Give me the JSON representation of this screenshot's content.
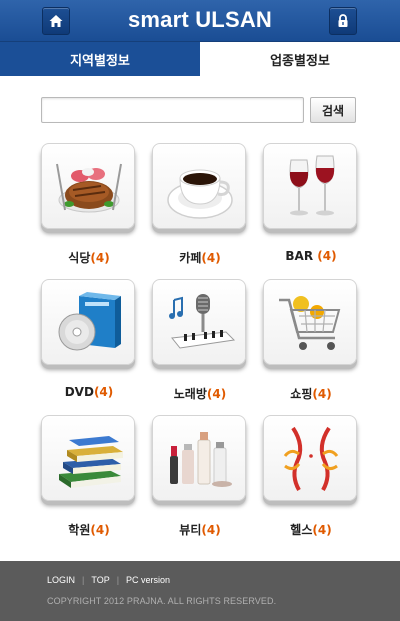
{
  "header": {
    "title": "smart ULSAN",
    "home_icon": "home-icon",
    "lock_icon": "lock-icon"
  },
  "tabs": [
    {
      "label": "지역별정보",
      "active": false
    },
    {
      "label": "업종별정보",
      "active": true
    }
  ],
  "search": {
    "value": "",
    "placeholder": "",
    "button_label": "검색"
  },
  "categories": [
    {
      "name": "식당",
      "count": "(4)",
      "icon": "steak-icon"
    },
    {
      "name": "카페",
      "count": "(4)",
      "icon": "coffee-cup-icon"
    },
    {
      "name": "BAR",
      "count": "(4)",
      "icon": "wine-glasses-icon"
    },
    {
      "name": "DVD",
      "count": "(4)",
      "icon": "dvd-box-icon"
    },
    {
      "name": "노래방",
      "count": "(4)",
      "icon": "microphone-piano-icon"
    },
    {
      "name": "쇼핑",
      "count": "(4)",
      "icon": "shopping-cart-icon"
    },
    {
      "name": "학원",
      "count": "(4)",
      "icon": "books-icon"
    },
    {
      "name": "뷰티",
      "count": "(4)",
      "icon": "cosmetics-icon"
    },
    {
      "name": "헬스",
      "count": "(4)",
      "icon": "body-silhouette-icon"
    }
  ],
  "footer": {
    "links": [
      "LOGIN",
      "TOP",
      "PC version"
    ],
    "copyright": "COPYRIGHT 2012 PRAJNA. ALL RIGHTS RESERVED."
  },
  "colors": {
    "header_blue": "#1b4f97",
    "count_orange": "#e05a00",
    "footer_gray": "#5b5b5b"
  }
}
